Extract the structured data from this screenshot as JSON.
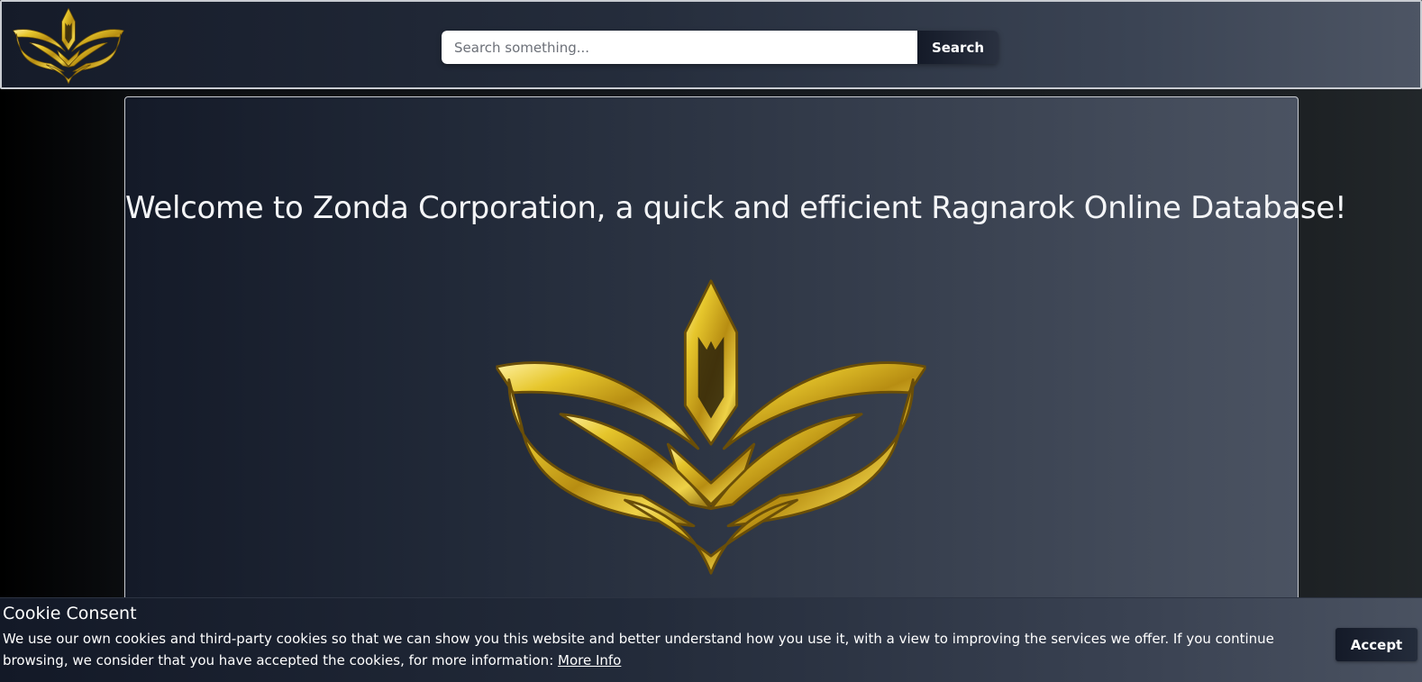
{
  "header": {
    "logo": "zonda-crest-logo",
    "search": {
      "placeholder": "Search something...",
      "value": "",
      "button_label": "Search"
    }
  },
  "hero": {
    "title": "Welcome to Zonda Corporation, a quick and efficient Ragnarok Online Database!",
    "logo": "zonda-crest-logo"
  },
  "cookie_banner": {
    "title": "Cookie Consent",
    "text": "We use our own cookies and third-party cookies so that we can show you this website and better understand how you use it, with a view to improving the services we offer. If you continue browsing, we consider that you have accepted the cookies, for more information: ",
    "link_label": "More Info",
    "accept_label": "Accept"
  },
  "colors": {
    "gold": "#d8b622",
    "navy": "#141a28",
    "slate": "#4b5362"
  }
}
